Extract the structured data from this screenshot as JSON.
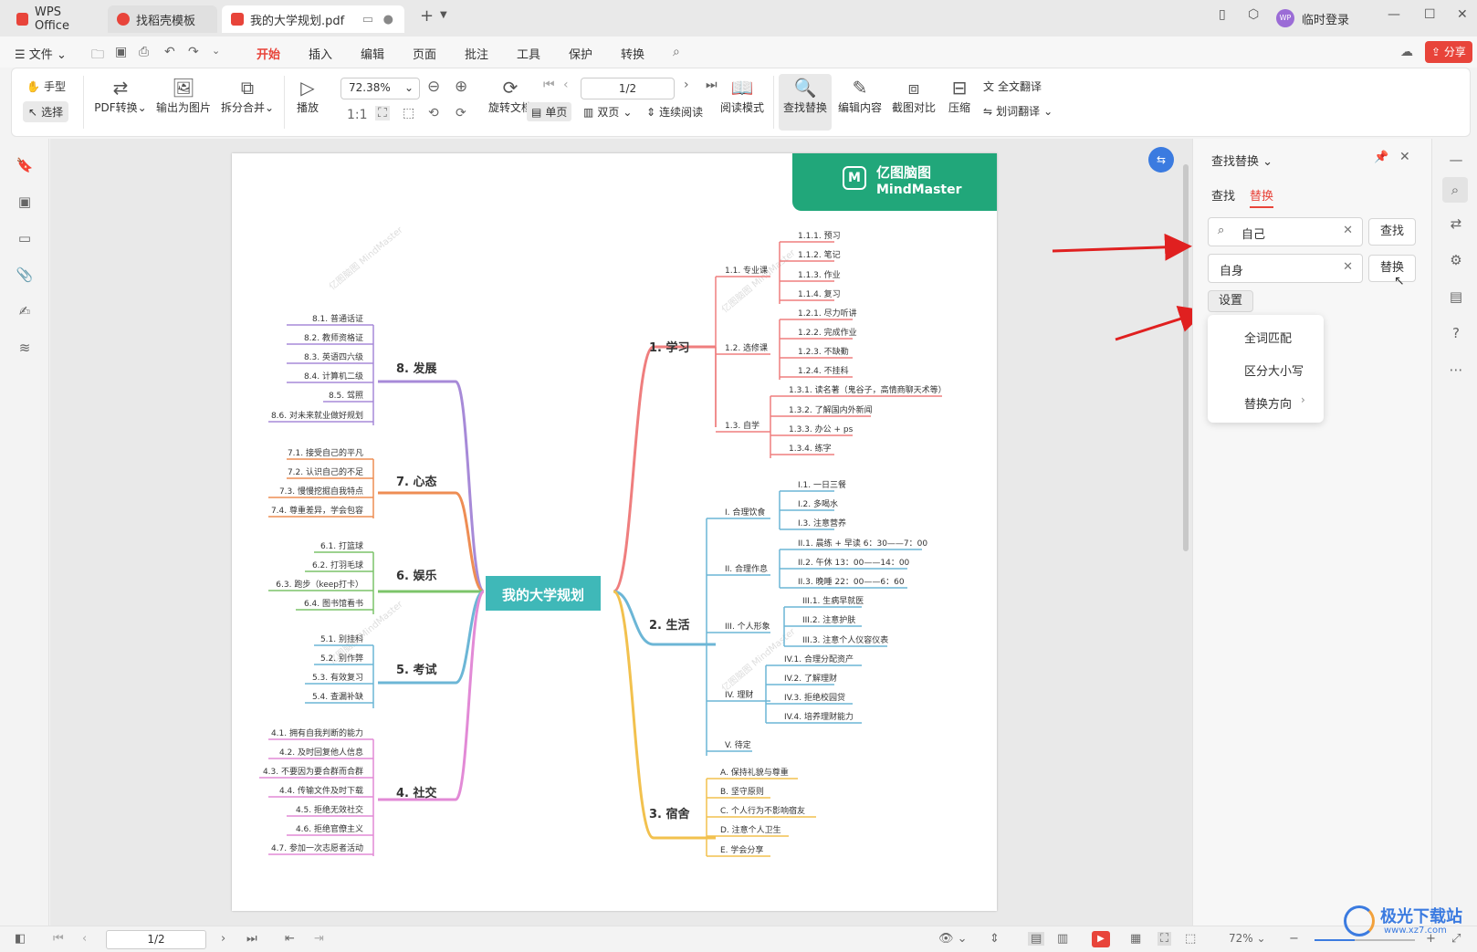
{
  "tabs": [
    {
      "label": "WPS Office"
    },
    {
      "label": "找稻壳模板"
    },
    {
      "label": "我的大学规划.pdf"
    }
  ],
  "window": {
    "user": "临时登录"
  },
  "menu": {
    "file": "文件",
    "items": [
      "开始",
      "插入",
      "编辑",
      "页面",
      "批注",
      "工具",
      "保护",
      "转换"
    ],
    "share": "分享"
  },
  "ribbon": {
    "hand": "手型",
    "select": "选择",
    "pdf_convert": "PDF转换",
    "export_img": "输出为图片",
    "split_merge": "拆分合并",
    "play": "播放",
    "zoom": "72.38%",
    "rotate": "旋转文档",
    "page": "1/2",
    "single": "单页",
    "double": "双页",
    "continuous": "连续阅读",
    "read_mode": "阅读模式",
    "find_replace": "查找替换",
    "edit_content": "编辑内容",
    "screenshot_compare": "截图对比",
    "compress": "压缩",
    "full_translate": "全文翻译",
    "word_translate": "划词翻译"
  },
  "mindmap": {
    "brand_cn": "亿图脑图",
    "brand_en": "MindMaster",
    "root": "我的大学规划",
    "branches": {
      "b1": "1. 学习",
      "b2": "2. 生活",
      "b3": "3. 宿舍",
      "b4": "4. 社交",
      "b5": "5. 考试",
      "b6": "6. 娱乐",
      "b7": "7. 心态",
      "b8": "8. 发展"
    },
    "study": {
      "s11": "1.1. 专业课",
      "s12": "1.2. 选修课",
      "s13": "1.3. 自学",
      "l111": "1.1.1. 预习",
      "l112": "1.1.2. 笔记",
      "l113": "1.1.3. 作业",
      "l114": "1.1.4. 复习",
      "l121": "1.2.1. 尽力听讲",
      "l122": "1.2.2. 完成作业",
      "l123": "1.2.3. 不缺勤",
      "l124": "1.2.4. 不挂科",
      "l131": "1.3.1. 读名著（鬼谷子，高情商聊天术等）",
      "l132": "1.3.2. 了解国内外新闻",
      "l133": "1.3.3. 办公 + ps",
      "l134": "1.3.4. 练字"
    },
    "life": {
      "s1": "I. 合理饮食",
      "s2": "II. 合理作息",
      "s3": "III. 个人形象",
      "s4": "IV. 理财",
      "s5": "V. 待定",
      "l11": "I.1. 一日三餐",
      "l12": "I.2. 多喝水",
      "l13": "I.3. 注意营养",
      "l21": "II.1. 晨练 + 早读 6：30——7：00",
      "l22": "II.2. 午休 13：00——14：00",
      "l23": "II.3. 晚睡 22：00——6：60",
      "l31": "III.1. 生病早就医",
      "l32": "III.2. 注意护肤",
      "l33": "III.3. 注意个人仪容仪表",
      "l41": "IV.1. 合理分配资产",
      "l42": "IV.2. 了解理财",
      "l43": "IV.3. 拒绝校园贷",
      "l44": "IV.4. 培养理财能力"
    },
    "dorm": [
      "A. 保持礼貌与尊重",
      "B. 坚守原则",
      "C. 个人行为不影响宿友",
      "D. 注意个人卫生",
      "E. 学会分享"
    ],
    "develop": [
      "8.1. 普通话证",
      "8.2. 教师资格证",
      "8.3. 英语四六级",
      "8.4. 计算机二级",
      "8.5. 驾照",
      "8.6. 对未来就业做好规划"
    ],
    "mind": [
      "7.1. 接受自己的平凡",
      "7.2. 认识自己的不足",
      "7.3. 慢慢挖掘自我特点",
      "7.4. 尊重差异，学会包容"
    ],
    "fun": [
      "6.1. 打篮球",
      "6.2. 打羽毛球",
      "6.3. 跑步（keep打卡）",
      "6.4. 图书馆看书"
    ],
    "exam": [
      "5.1. 别挂科",
      "5.2. 别作弊",
      "5.3. 有效复习",
      "5.4. 查漏补缺"
    ],
    "social": [
      "4.1. 拥有自我判断的能力",
      "4.2. 及时回复他人信息",
      "4.3. 不要因为要合群而合群",
      "4.4. 传输文件及时下载",
      "4.5. 拒绝无效社交",
      "4.6. 拒绝官僚主义",
      "4.7. 参加一次志愿者活动"
    ]
  },
  "panel": {
    "title": "查找替换",
    "tab_find": "查找",
    "tab_replace": "替换",
    "find_value": "自己",
    "replace_value": "自身",
    "find_btn": "查找",
    "replace_btn": "替换",
    "settings": "设置",
    "options": [
      "全词匹配",
      "区分大小写",
      "替换方向"
    ]
  },
  "status": {
    "page": "1/2",
    "zoom": "72%"
  },
  "watermark": "极光下载站",
  "watermark_url": "www.xz7.com"
}
